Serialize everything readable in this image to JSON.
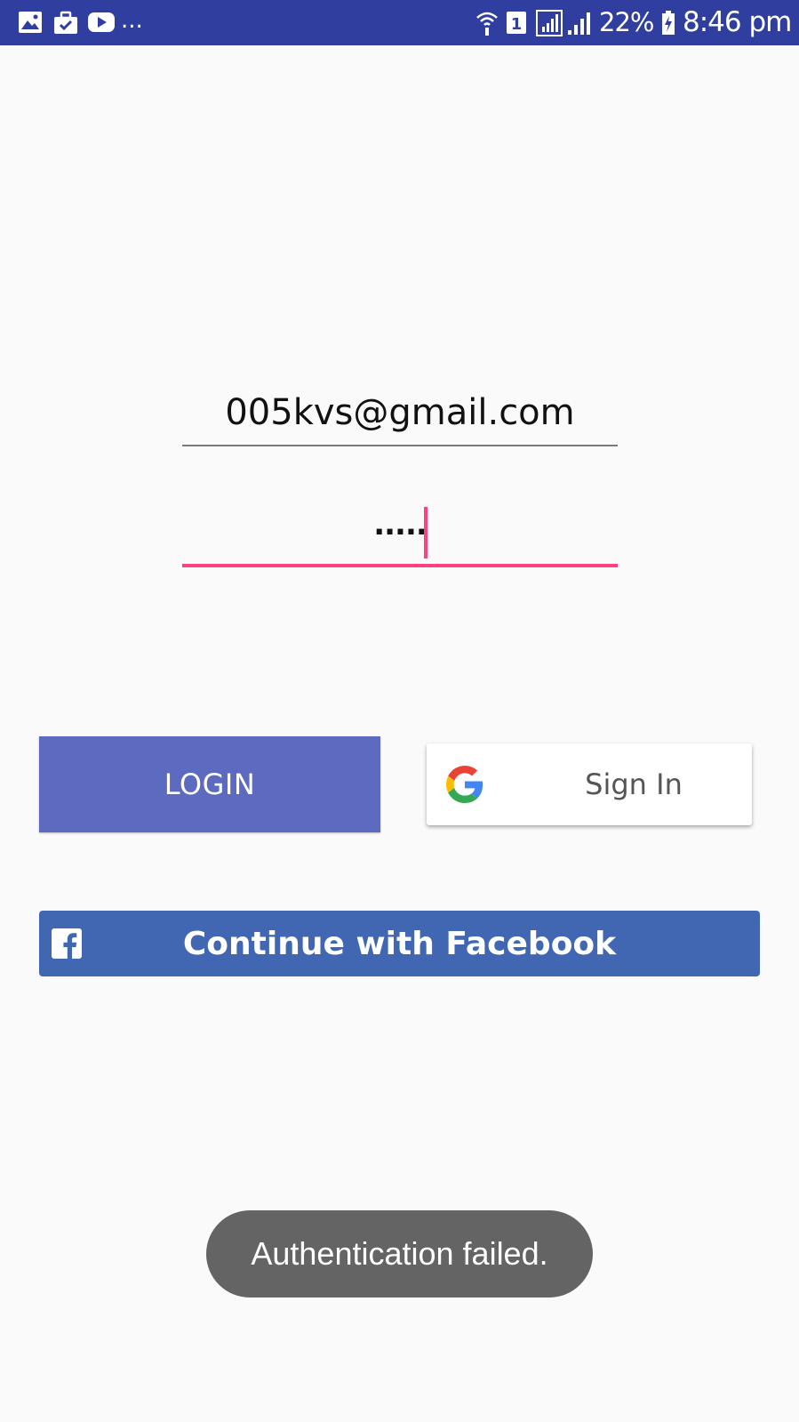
{
  "status_bar": {
    "more_indicator": "...",
    "sim_slot": "1",
    "battery_percent": "22%",
    "time": "8:46 pm",
    "notification_icons": [
      "gallery-icon",
      "briefcase-icon",
      "youtube-icon"
    ],
    "background_color": "#303f9f"
  },
  "login_form": {
    "email_value": "005kvs@gmail.com",
    "password_value": ".....",
    "focus_underline_color": "#ff4081"
  },
  "buttons": {
    "login_label": "LOGIN",
    "login_color": "#5c6bc0",
    "google_label": "Sign In",
    "facebook_label": "Continue with Facebook",
    "facebook_color": "#4267b2"
  },
  "toast": {
    "message": "Authentication failed."
  }
}
